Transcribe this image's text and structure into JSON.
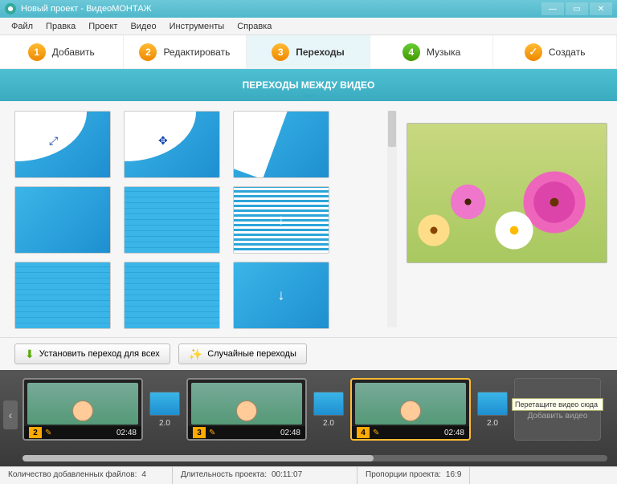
{
  "window": {
    "title": "Новый проект - ВидеоМОНТАЖ"
  },
  "menu": {
    "file": "Файл",
    "edit": "Правка",
    "project": "Проект",
    "video": "Видео",
    "tools": "Инструменты",
    "help": "Справка"
  },
  "steps": {
    "s1": "Добавить",
    "s2": "Редактировать",
    "s3": "Переходы",
    "s4": "Музыка",
    "s5": "Создать"
  },
  "section": {
    "title": "ПЕРЕХОДЫ МЕЖДУ ВИДЕО"
  },
  "buttons": {
    "apply_all": "Установить переход для всех",
    "random": "Случайные переходы"
  },
  "timeline": {
    "clips": [
      {
        "num": "2",
        "time": "02:48"
      },
      {
        "num": "3",
        "time": "02:48"
      },
      {
        "num": "4",
        "time": "02:48"
      }
    ],
    "trans_dur": "2.0",
    "add": "Добавить видео",
    "tooltip": "Перетащите видео сюда"
  },
  "status": {
    "files_label": "Количество добавленных файлов:",
    "files_val": "4",
    "dur_label": "Длительность проекта:",
    "dur_val": "00:11:07",
    "prop_label": "Пропорции проекта:",
    "prop_val": "16:9"
  }
}
